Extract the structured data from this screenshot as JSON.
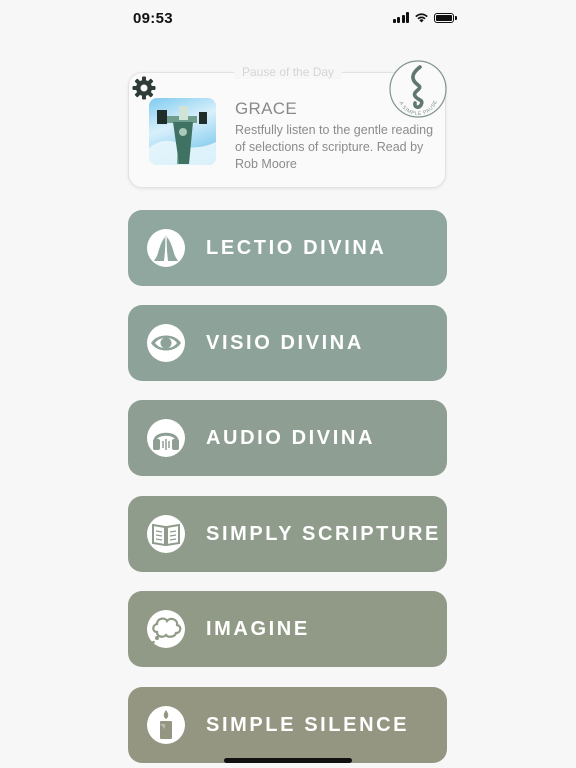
{
  "status_bar": {
    "time": "09:53"
  },
  "featured": {
    "section_title": "Pause of the Day",
    "title": "GRACE",
    "description": "Restfully listen to the gentle reading of selections of scripture. Read by Rob Moore",
    "logo_text": "A SIMPLE PAUSE"
  },
  "menu": [
    {
      "label": "LECTIO DIVINA",
      "icon": "praying-hands-icon",
      "color": "#8fa79e"
    },
    {
      "label": "VISIO DIVINA",
      "icon": "eye-icon",
      "color": "#8da298"
    },
    {
      "label": "AUDIO DIVINA",
      "icon": "headphones-icon",
      "color": "#8e9e92"
    },
    {
      "label": "SIMPLY SCRIPTURE",
      "icon": "book-icon",
      "color": "#8f9c8b"
    },
    {
      "label": "IMAGINE",
      "icon": "thought-bubble-icon",
      "color": "#919a86"
    },
    {
      "label": "SIMPLE SILENCE",
      "icon": "candle-icon",
      "color": "#949682"
    }
  ]
}
